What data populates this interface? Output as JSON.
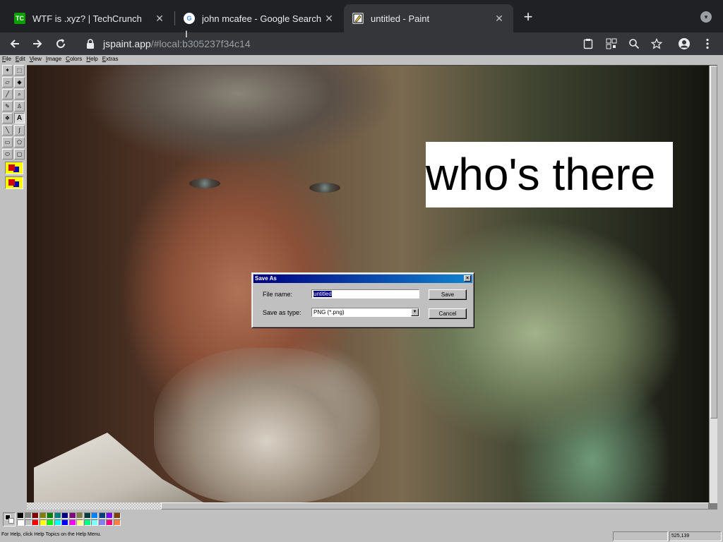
{
  "browser": {
    "tabs": [
      {
        "favicon": "TC",
        "favicon_color": "#0a9e01",
        "title": "WTF is .xyz? | TechCrunch",
        "active": false
      },
      {
        "favicon": "G",
        "favicon_color": "#ffffff",
        "title": "john mcafee - Google Search",
        "active": false
      },
      {
        "favicon": "paint-icon",
        "favicon_color": "#c0c0c0",
        "title": "untitled - Paint",
        "active": true
      }
    ],
    "close_glyph": "✕",
    "new_tab_glyph": "+",
    "url_host": "jspaint.app",
    "url_path": "/#local:b305237f34c14"
  },
  "paint": {
    "menu": [
      "File",
      "Edit",
      "View",
      "Image",
      "Colors",
      "Help",
      "Extras"
    ],
    "canvas_text": "who's there",
    "status_message": "For Help, click Help Topics on the Help Menu.",
    "status_coords": "525,139",
    "palette": [
      "#000000",
      "#808080",
      "#800000",
      "#808000",
      "#008000",
      "#008080",
      "#000080",
      "#800080",
      "#808040",
      "#004040",
      "#0080ff",
      "#004080",
      "#8000ff",
      "#804000",
      "#ffffff",
      "#c0c0c0",
      "#ff0000",
      "#ffff00",
      "#00ff00",
      "#00ffff",
      "#0000ff",
      "#ff00ff",
      "#ffff80",
      "#00ff80",
      "#80ffff",
      "#8080ff",
      "#ff0080",
      "#ff8040"
    ]
  },
  "dialog": {
    "title": "Save As",
    "close_glyph": "×",
    "file_name_label": "File name:",
    "file_name_value": "untitled",
    "save_type_label": "Save as type:",
    "save_type_value": "PNG (*.png)",
    "save_button": "Save",
    "cancel_button": "Cancel"
  }
}
